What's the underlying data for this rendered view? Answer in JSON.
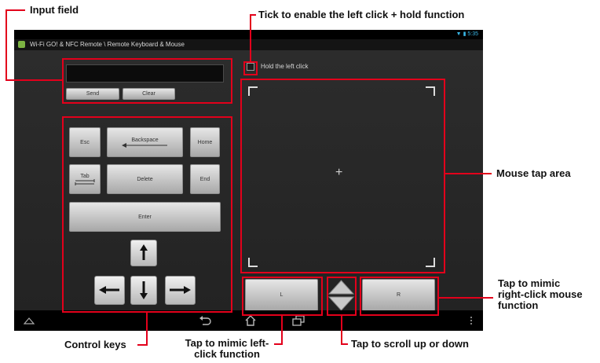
{
  "annotations": {
    "input_field": "Input field",
    "hold_tick": "Tick to enable the left click + hold function",
    "mouse_tap": "Mouse tap area",
    "right_click_1": "Tap to mimic",
    "right_click_2": "right-click mouse",
    "right_click_3": "function",
    "control_keys": "Control keys",
    "left_click_1": "Tap to mimic left-",
    "left_click_2": "click function",
    "scroll": "Tap to scroll up or down"
  },
  "app": {
    "title": "Wi-Fi GO! & NFC Remote \\ Remote Keyboard & Mouse",
    "status_time": "5:35"
  },
  "input": {
    "value": "",
    "send_label": "Send",
    "clear_label": "Clear"
  },
  "keys": {
    "esc": "Esc",
    "backspace": "Backspace",
    "home": "Home",
    "tab": "Tab",
    "delete": "Delete",
    "end": "End",
    "enter": "Enter"
  },
  "mouse": {
    "hold_label": "Hold the left click",
    "hold_checked": false,
    "crosshair": "+",
    "left_label": "L",
    "right_label": "R"
  },
  "icons": [
    "back-icon",
    "home-icon",
    "recent-apps-icon",
    "menu-icon",
    "up-arrow-icon",
    "down-arrow-icon",
    "left-arrow-icon",
    "right-arrow-icon",
    "wifi-icon",
    "battery-icon"
  ],
  "colors": {
    "annotation": "#e3001b",
    "screen_bg": "#232323",
    "button_light": "#d9d9d9",
    "status_accent": "#39b6e6"
  }
}
